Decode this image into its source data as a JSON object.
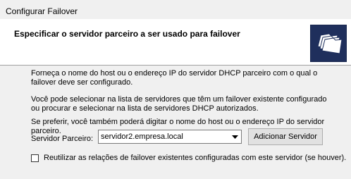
{
  "window": {
    "title": "Configurar Failover"
  },
  "header": {
    "heading": "Especificar o servidor parceiro a ser usado para failover",
    "icon": "folders-icon"
  },
  "body": {
    "paragraph1_line1": "Forneça o nome do host ou o endereço IP do servidor DHCP parceiro com o qual o",
    "paragraph1_line2": "failover deve ser configurado.",
    "paragraph2_line1": "Você pode selecionar na lista de servidores que têm um failover existente configurado",
    "paragraph2_line2": "ou procurar e selecionar na lista de servidores DHCP autorizados.",
    "paragraph3_line1": "Se preferir, você também poderá digitar o nome do host ou o endereço IP do servidor",
    "paragraph3_line2": "parceiro."
  },
  "partner": {
    "label": "Servidor Parceiro:",
    "value": "servidor2.empresa.local",
    "add_button": "Adicionar Servidor"
  },
  "reuse": {
    "label": "Reutilizar as relações de failover existentes configuradas com este servidor (se houver).",
    "checked": false
  }
}
